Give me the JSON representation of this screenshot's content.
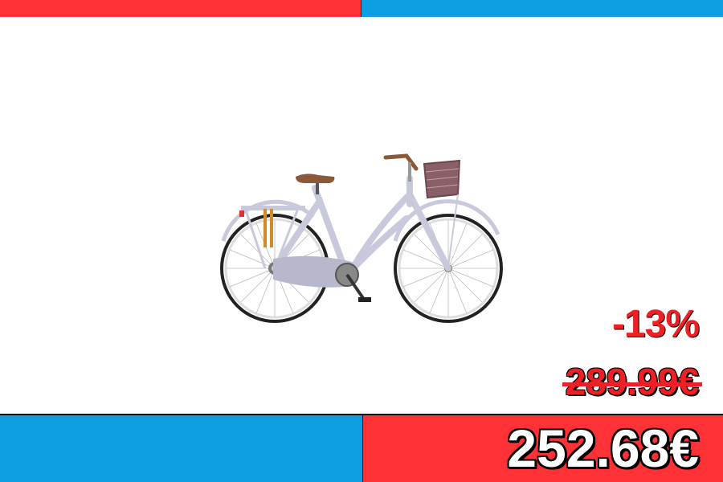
{
  "pricing": {
    "discount": "-13%",
    "old_price": "289.99€",
    "new_price": "252.68€"
  },
  "product": {
    "image": "ladies-city-bicycle-with-basket-icon"
  },
  "colors": {
    "red": "#fe3136",
    "blue": "#0c9ee0",
    "bike_frame": "#c9c9dc",
    "saddle": "#8a5a38",
    "basket": "#8a6068"
  }
}
